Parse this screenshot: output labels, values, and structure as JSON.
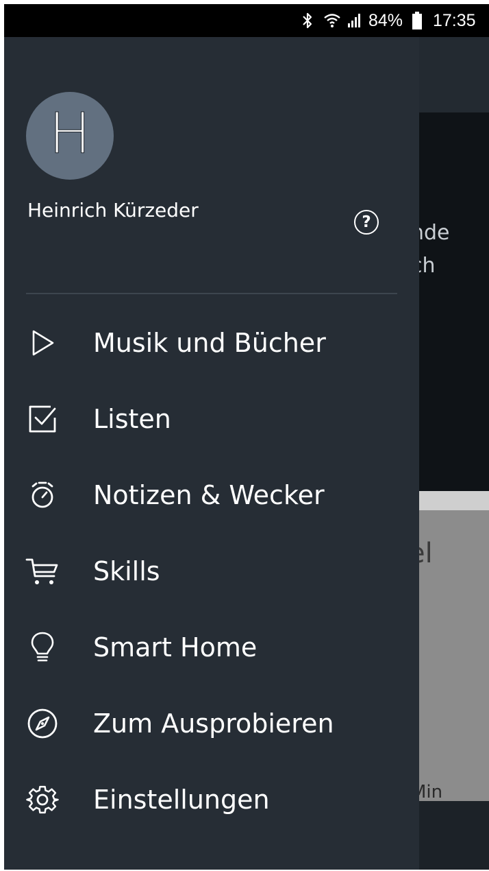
{
  "status_bar": {
    "battery": "84%",
    "time": "17:35",
    "icons": [
      "bluetooth-icon",
      "wifi-icon",
      "signal-icon",
      "battery-icon"
    ]
  },
  "background": {
    "fragment_1": "nde",
    "fragment_2": "ch",
    "fragment_3": "el",
    "fragment_4": "Min"
  },
  "drawer": {
    "avatar_letter": "H",
    "user_name": "Heinrich Kürzeder",
    "help_symbol": "?",
    "menu": [
      {
        "label": "Musik und Bücher",
        "icon": "play-icon"
      },
      {
        "label": "Listen",
        "icon": "checklist-icon"
      },
      {
        "label": "Notizen & Wecker",
        "icon": "timer-icon"
      },
      {
        "label": "Skills",
        "icon": "cart-icon"
      },
      {
        "label": "Smart Home",
        "icon": "lightbulb-icon"
      },
      {
        "label": "Zum Ausprobieren",
        "icon": "compass-icon"
      },
      {
        "label": "Einstellungen",
        "icon": "gear-icon"
      }
    ]
  },
  "colors": {
    "drawer_bg": "#262d35",
    "avatar_bg": "#627080",
    "status_bar_bg": "#000000"
  }
}
